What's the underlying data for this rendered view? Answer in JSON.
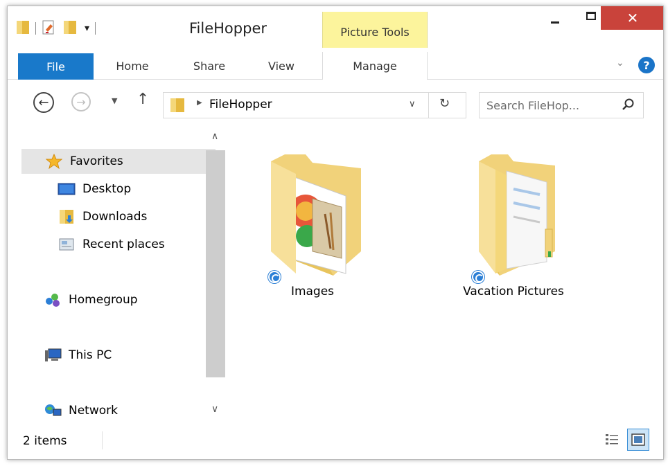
{
  "window": {
    "title": "FileHopper",
    "context_tab_group": "Picture Tools",
    "close_glyph": "✕"
  },
  "quick_access": {
    "icons": [
      "folder-icon",
      "properties-icon",
      "new-folder-icon",
      "customize-arrow-icon"
    ],
    "customize_glyph": "▾"
  },
  "ribbon": {
    "tabs": [
      {
        "label": "File"
      },
      {
        "label": "Home"
      },
      {
        "label": "Share"
      },
      {
        "label": "View"
      },
      {
        "label": "Manage"
      }
    ],
    "expand_glyph": "⌄",
    "help_glyph": "?"
  },
  "address_bar": {
    "back_glyph": "←",
    "forward_glyph": "→",
    "recent_glyph": "▼",
    "up_glyph": "↑",
    "chevron_glyph": "▶",
    "path": "FileHopper",
    "dropdown_glyph": "∨",
    "refresh_glyph": "↻"
  },
  "search": {
    "placeholder": "Search FileHop...",
    "value": ""
  },
  "nav_pane": {
    "favorites": "Favorites",
    "desktop": "Desktop",
    "downloads": "Downloads",
    "recent_places": "Recent places",
    "homegroup": "Homegroup",
    "this_pc": "This PC",
    "network": "Network",
    "scroll_up_glyph": "∧",
    "scroll_down_glyph": "∨"
  },
  "content": {
    "items": [
      {
        "name": "Images"
      },
      {
        "name": "Vacation Pictures"
      }
    ]
  },
  "status": {
    "item_count": "2 items"
  },
  "colors": {
    "file_tab": "#1979ca",
    "context_tab": "#fcf49c",
    "close_button": "#c9433b",
    "folder": "#f4d77a",
    "selection": "#e5e5e5"
  }
}
